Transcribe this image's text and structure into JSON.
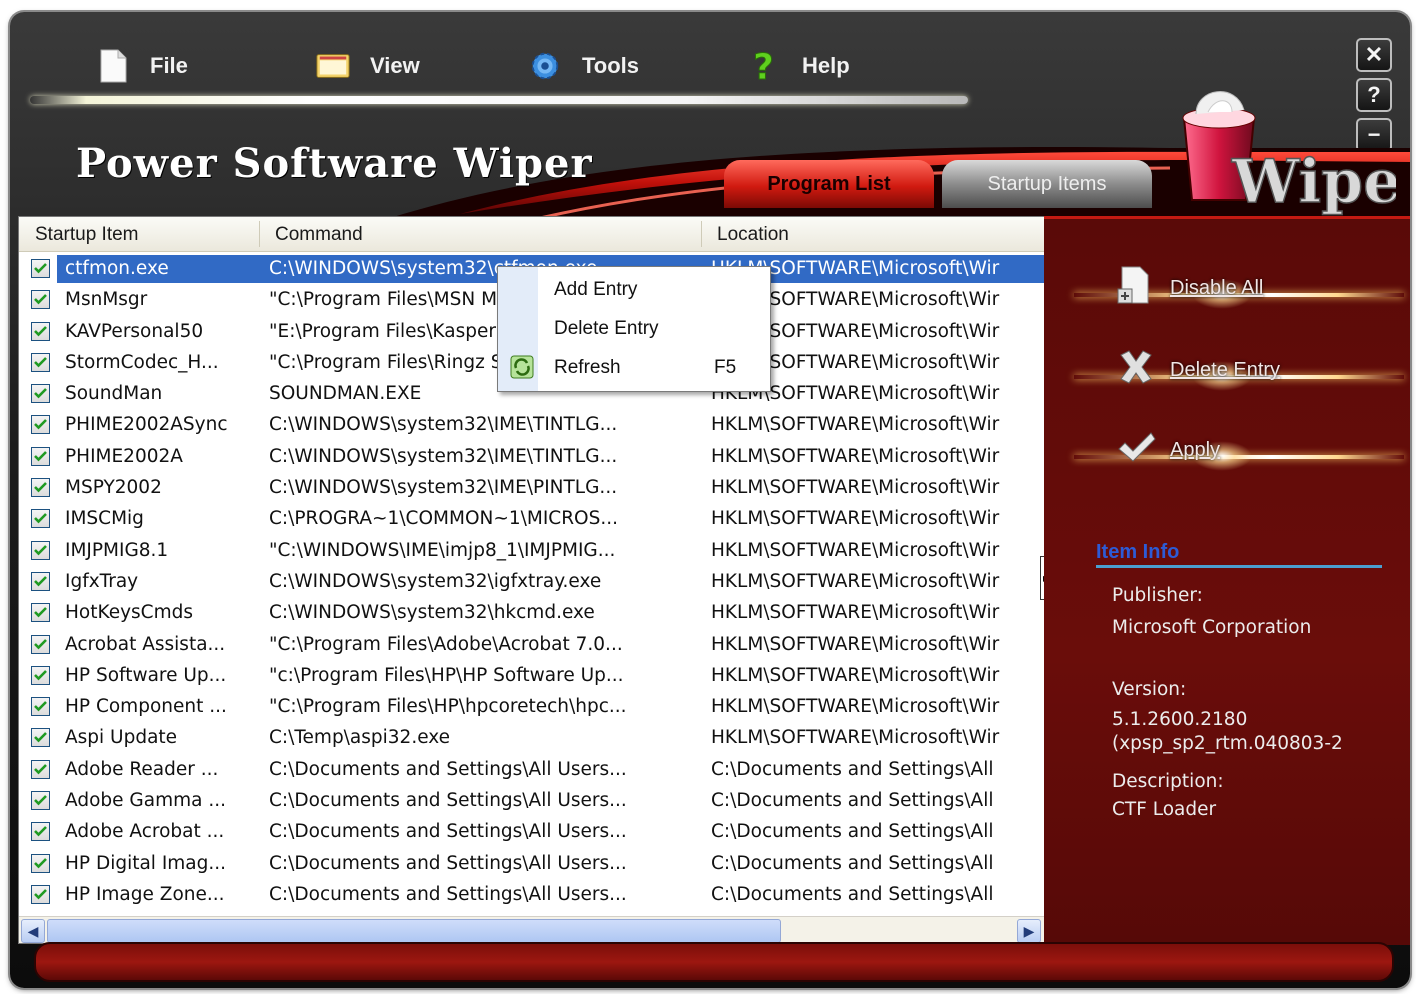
{
  "menu": {
    "file": "File",
    "view": "View",
    "tools": "Tools",
    "help": "Help"
  },
  "app_title": "Power Software Wiper",
  "logo_text": "Wiper",
  "window_buttons": {
    "close": "✕",
    "help": "?",
    "minimize": "−"
  },
  "tabs": {
    "program_list": "Program List",
    "startup_items": "Startup Items"
  },
  "columns": {
    "startup_item": "Startup Item",
    "command": "Command",
    "location": "Location"
  },
  "rows": [
    {
      "name": "ctfmon.exe",
      "command": "C:\\WINDOWS\\system32\\ctfmon.exe",
      "location": "HKLM\\SOFTWARE\\Microsoft\\Wir"
    },
    {
      "name": "MsnMsgr",
      "command": "\"C:\\Program Files\\MSN Messenger\\...",
      "location": "HKLM\\SOFTWARE\\Microsoft\\Wir"
    },
    {
      "name": "KAVPersonal50",
      "command": "\"E:\\Program Files\\Kaspersky Lab\\...",
      "location": "HKLM\\SOFTWARE\\Microsoft\\Wir"
    },
    {
      "name": "StormCodec_H...",
      "command": "\"C:\\Program Files\\Ringz Studio\\...",
      "location": "HKLM\\SOFTWARE\\Microsoft\\Wir"
    },
    {
      "name": "SoundMan",
      "command": "SOUNDMAN.EXE",
      "location": "HKLM\\SOFTWARE\\Microsoft\\Wir"
    },
    {
      "name": "PHIME2002ASync",
      "command": "C:\\WINDOWS\\system32\\IME\\TINTLG...",
      "location": "HKLM\\SOFTWARE\\Microsoft\\Wir"
    },
    {
      "name": "PHIME2002A",
      "command": "C:\\WINDOWS\\system32\\IME\\TINTLG...",
      "location": "HKLM\\SOFTWARE\\Microsoft\\Wir"
    },
    {
      "name": "MSPY2002",
      "command": "C:\\WINDOWS\\system32\\IME\\PINTLG...",
      "location": "HKLM\\SOFTWARE\\Microsoft\\Wir"
    },
    {
      "name": "IMSCMig",
      "command": "C:\\PROGRA~1\\COMMON~1\\MICROS...",
      "location": "HKLM\\SOFTWARE\\Microsoft\\Wir"
    },
    {
      "name": "IMJPMIG8.1",
      "command": "\"C:\\WINDOWS\\IME\\imjp8_1\\IMJPMIG...",
      "location": "HKLM\\SOFTWARE\\Microsoft\\Wir"
    },
    {
      "name": "IgfxTray",
      "command": "C:\\WINDOWS\\system32\\igfxtray.exe",
      "location": "HKLM\\SOFTWARE\\Microsoft\\Wir"
    },
    {
      "name": "HotKeysCmds",
      "command": "C:\\WINDOWS\\system32\\hkcmd.exe",
      "location": "HKLM\\SOFTWARE\\Microsoft\\Wir"
    },
    {
      "name": "Acrobat Assista...",
      "command": "\"C:\\Program Files\\Adobe\\Acrobat 7.0...",
      "location": "HKLM\\SOFTWARE\\Microsoft\\Wir"
    },
    {
      "name": "HP Software Up...",
      "command": "\"c:\\Program Files\\HP\\HP Software Up...",
      "location": "HKLM\\SOFTWARE\\Microsoft\\Wir"
    },
    {
      "name": "HP Component ...",
      "command": "\"C:\\Program Files\\HP\\hpcoretech\\hpc...",
      "location": "HKLM\\SOFTWARE\\Microsoft\\Wir"
    },
    {
      "name": "Aspi Update",
      "command": "C:\\Temp\\aspi32.exe",
      "location": "HKLM\\SOFTWARE\\Microsoft\\Wir"
    },
    {
      "name": "Adobe Reader ...",
      "command": "C:\\Documents and Settings\\All Users...",
      "location": "C:\\Documents and Settings\\All"
    },
    {
      "name": "Adobe Gamma ...",
      "command": "C:\\Documents and Settings\\All Users...",
      "location": "C:\\Documents and Settings\\All"
    },
    {
      "name": "Adobe Acrobat ...",
      "command": "C:\\Documents and Settings\\All Users...",
      "location": "C:\\Documents and Settings\\All"
    },
    {
      "name": "HP Digital Imag...",
      "command": "C:\\Documents and Settings\\All Users...",
      "location": "C:\\Documents and Settings\\All"
    },
    {
      "name": "HP Image Zone...",
      "command": "C:\\Documents and Settings\\All Users...",
      "location": "C:\\Documents and Settings\\All"
    }
  ],
  "context_menu": {
    "add_entry": "Add Entry",
    "delete_entry": "Delete Entry",
    "refresh": "Refresh",
    "refresh_shortcut": "F5"
  },
  "actions": {
    "disable_all": "Disable All",
    "delete_entry": "Delete Entry",
    "apply": "Apply"
  },
  "item_info": {
    "title": "Item Info",
    "publisher_label": "Publisher:",
    "publisher": "Microsoft Corporation",
    "version_label": "Version:",
    "version_line1": "5.1.2600.2180",
    "version_line2": "(xpsp_sp2_rtm.040803-2",
    "description_label": "Description:",
    "description": "CTF Loader"
  },
  "selected_row": 0,
  "colors": {
    "accent_red": "#c41a12",
    "selection": "#316ac5",
    "side_panel": "#5a0a08"
  }
}
